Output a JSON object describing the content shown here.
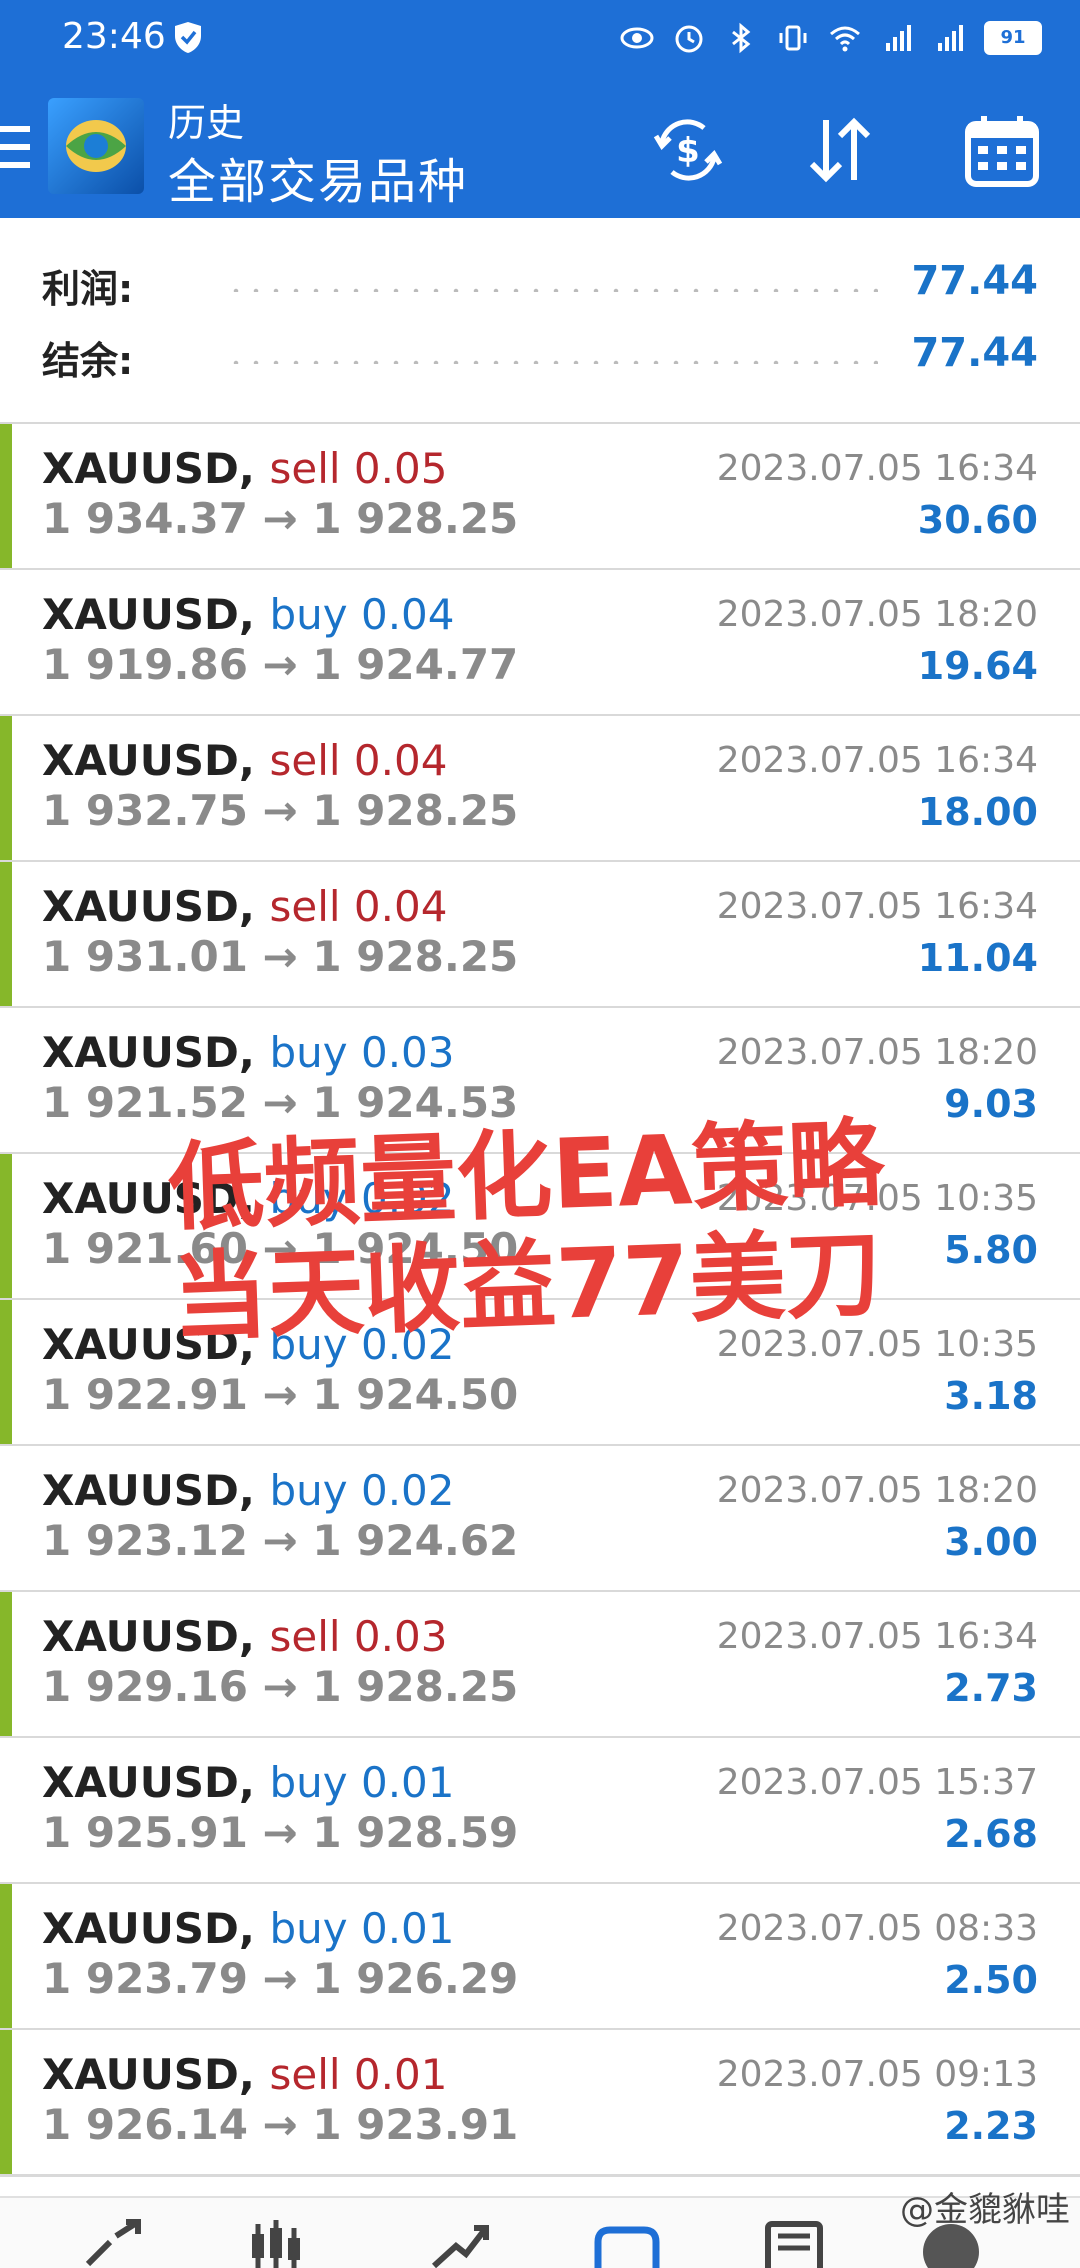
{
  "status_bar": {
    "time": "23:46",
    "battery": "91",
    "icons": [
      "eye-icon",
      "alarm-icon",
      "bluetooth-icon",
      "vibrate-icon",
      "wifi-icon",
      "signal-4g-icon",
      "signal-4g-icon",
      "battery-icon"
    ]
  },
  "app_bar": {
    "title": "历史",
    "subtitle": "全部交易品种",
    "actions": [
      "currency-exchange-icon",
      "sort-icon",
      "calendar-icon"
    ]
  },
  "summary": {
    "profit_label": "利润:",
    "profit_value": "77.44",
    "balance_label": "结余:",
    "balance_value": "77.44"
  },
  "deals": [
    {
      "symbol": "XAUUSD,",
      "side": "sell",
      "volume": "0.05",
      "open": "1 934.37",
      "close": "1 928.25",
      "time": "2023.07.05 16:34",
      "profit": "30.60"
    },
    {
      "symbol": "XAUUSD,",
      "side": "buy",
      "volume": "0.04",
      "open": "1 919.86",
      "close": "1 924.77",
      "time": "2023.07.05 18:20",
      "profit": "19.64"
    },
    {
      "symbol": "XAUUSD,",
      "side": "sell",
      "volume": "0.04",
      "open": "1 932.75",
      "close": "1 928.25",
      "time": "2023.07.05 16:34",
      "profit": "18.00"
    },
    {
      "symbol": "XAUUSD,",
      "side": "sell",
      "volume": "0.04",
      "open": "1 931.01",
      "close": "1 928.25",
      "time": "2023.07.05 16:34",
      "profit": "11.04"
    },
    {
      "symbol": "XAUUSD,",
      "side": "buy",
      "volume": "0.03",
      "open": "1 921.52",
      "close": "1 924.53",
      "time": "2023.07.05 18:20",
      "profit": "9.03"
    },
    {
      "symbol": "XAUUSD,",
      "side": "buy",
      "volume": "0.02",
      "open": "1 921.60",
      "close": "1 924.50",
      "time": "2023.07.05 10:35",
      "profit": "5.80"
    },
    {
      "symbol": "XAUUSD,",
      "side": "buy",
      "volume": "0.02",
      "open": "1 922.91",
      "close": "1 924.50",
      "time": "2023.07.05 10:35",
      "profit": "3.18"
    },
    {
      "symbol": "XAUUSD,",
      "side": "buy",
      "volume": "0.02",
      "open": "1 923.12",
      "close": "1 924.62",
      "time": "2023.07.05 18:20",
      "profit": "3.00"
    },
    {
      "symbol": "XAUUSD,",
      "side": "sell",
      "volume": "0.03",
      "open": "1 929.16",
      "close": "1 928.25",
      "time": "2023.07.05 16:34",
      "profit": "2.73"
    },
    {
      "symbol": "XAUUSD,",
      "side": "buy",
      "volume": "0.01",
      "open": "1 925.91",
      "close": "1 928.59",
      "time": "2023.07.05 15:37",
      "profit": "2.68"
    },
    {
      "symbol": "XAUUSD,",
      "side": "buy",
      "volume": "0.01",
      "open": "1 923.79",
      "close": "1 926.29",
      "time": "2023.07.05 08:33",
      "profit": "2.50"
    },
    {
      "symbol": "XAUUSD,",
      "side": "sell",
      "volume": "0.01",
      "open": "1 926.14",
      "close": "1 923.91",
      "time": "2023.07.05 09:13",
      "profit": "2.23"
    }
  ],
  "overlay": {
    "line1": "低频量化EA策略",
    "line2": "当天收益77美刀"
  },
  "watermark": "@金貔貅哇",
  "bottom_nav": [
    "quotes-icon",
    "chart-icon",
    "trade-icon",
    "history-icon",
    "news-icon",
    "messages-icon"
  ],
  "colors": {
    "accent": "#1e6fd6",
    "sell": "#b5272d",
    "buy": "#1a73c8",
    "profit": "#1a73c8",
    "bar": "#86b72a",
    "overlay": "#e8403a"
  }
}
